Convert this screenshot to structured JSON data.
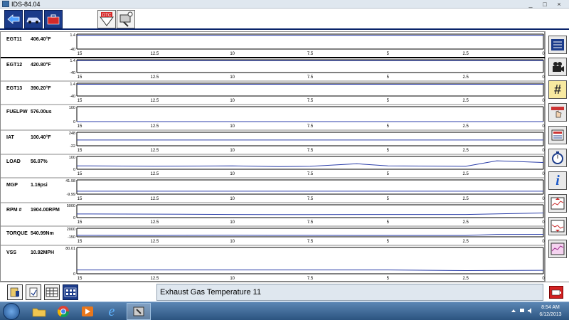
{
  "window": {
    "title": "IDS-84.04"
  },
  "toolbar": {
    "buttons": [
      {
        "name": "back-button",
        "icon": "arrow-left-icon"
      },
      {
        "name": "vehicle-button",
        "icon": "car-icon"
      },
      {
        "name": "toolbox-button",
        "icon": "toolbox-icon"
      },
      {
        "name": "dtc-button",
        "icon": "dtc-icon",
        "label": "DTC"
      },
      {
        "name": "datalogger-button",
        "icon": "probe-icon"
      }
    ]
  },
  "x_ticks": [
    "15",
    "12.5",
    "10",
    "7.5",
    "5",
    "2.5",
    "0"
  ],
  "chart_data": {
    "type": "line",
    "x_axis": {
      "label": "",
      "range": [
        15,
        0
      ],
      "ticks": [
        15,
        12.5,
        10,
        7.5,
        5,
        2.5,
        0
      ]
    },
    "series": [
      {
        "name": "EGT11",
        "value": "406.40°F",
        "ymax": "1.4",
        "ymin": "-40",
        "x": [
          15,
          0
        ],
        "y": [
          0.2,
          0.2
        ]
      },
      {
        "name": "EGT12",
        "value": "420.80°F",
        "ymax": "1.4",
        "ymin": "-40",
        "x": [
          15,
          0
        ],
        "y": [
          0.2,
          0.2
        ]
      },
      {
        "name": "EGT13",
        "value": "390.20°F",
        "ymax": "1.4",
        "ymin": "-40",
        "x": [
          15,
          0
        ],
        "y": [
          0.2,
          0.2
        ]
      },
      {
        "name": "FUELPW",
        "value": "576.00us",
        "ymax": "100",
        "ymin": "0",
        "x": [
          15,
          0
        ],
        "y": [
          0,
          0
        ]
      },
      {
        "name": "IAT",
        "value": "100.40°F",
        "ymax": "248",
        "ymin": "-22",
        "x": [
          15,
          0
        ],
        "y": [
          100,
          100
        ]
      },
      {
        "name": "LOAD",
        "value": "56.07%",
        "ymax": "100",
        "ymin": "0",
        "x": [
          15,
          12.5,
          10,
          8.5,
          7.5,
          6,
          5,
          2.5,
          1.5,
          1,
          0
        ],
        "y": [
          28,
          25,
          28,
          22,
          24,
          45,
          28,
          24,
          70,
          65,
          56
        ]
      },
      {
        "name": "MGP",
        "value": "1.16psi",
        "ymax": "41.98",
        "ymin": "-9.99",
        "x": [
          15,
          0
        ],
        "y": [
          1.2,
          1.2
        ]
      },
      {
        "name": "RPM #",
        "value": "1904.00RPM",
        "ymax": "5000",
        "ymin": "0",
        "x": [
          15,
          12.5,
          10,
          7.5,
          5,
          2.5,
          0
        ],
        "y": [
          1500,
          1450,
          1300,
          1250,
          1300,
          1300,
          1904
        ]
      },
      {
        "name": "TORQUE",
        "value": "540.99Nm",
        "ymax": "2000",
        "ymin": "-150",
        "x": [
          15,
          12.5,
          10,
          7.5,
          5,
          2.5,
          1.5,
          0
        ],
        "y": [
          250,
          230,
          260,
          240,
          230,
          230,
          520,
          541
        ]
      },
      {
        "name": "VSS",
        "value": "10.92MPH",
        "ymax": "80.01",
        "ymin": "0",
        "x": [
          15,
          12.5,
          10,
          7.5,
          5,
          2.5,
          0
        ],
        "y": [
          12,
          12,
          12,
          12,
          12,
          10,
          11
        ]
      }
    ]
  },
  "rightbar": {
    "buttons": [
      {
        "name": "list-button",
        "icon": "list-icon"
      },
      {
        "name": "record-button",
        "icon": "movie-camera-icon"
      },
      {
        "name": "number-button",
        "icon": "hash-icon"
      },
      {
        "name": "select-button",
        "icon": "hand-pointer-icon"
      },
      {
        "name": "layout-button",
        "icon": "panel-icon"
      },
      {
        "name": "timer-button",
        "icon": "stopwatch-icon"
      },
      {
        "name": "info-button",
        "icon": "info-icon"
      },
      {
        "name": "graph-up-button",
        "icon": "graph-up-icon"
      },
      {
        "name": "graph-down-button",
        "icon": "graph-down-icon"
      },
      {
        "name": "settings-graph-button",
        "icon": "graph-settings-icon"
      }
    ]
  },
  "bottombar": {
    "status": "Exhaust Gas Temperature 11"
  },
  "taskbar": {
    "clock_time": "8:54 AM",
    "clock_date": "6/12/2013"
  },
  "colors": {
    "accent": "#1b3b8a",
    "plot_line": "#2b3ea8",
    "status_bg": "#dfe7ef"
  }
}
